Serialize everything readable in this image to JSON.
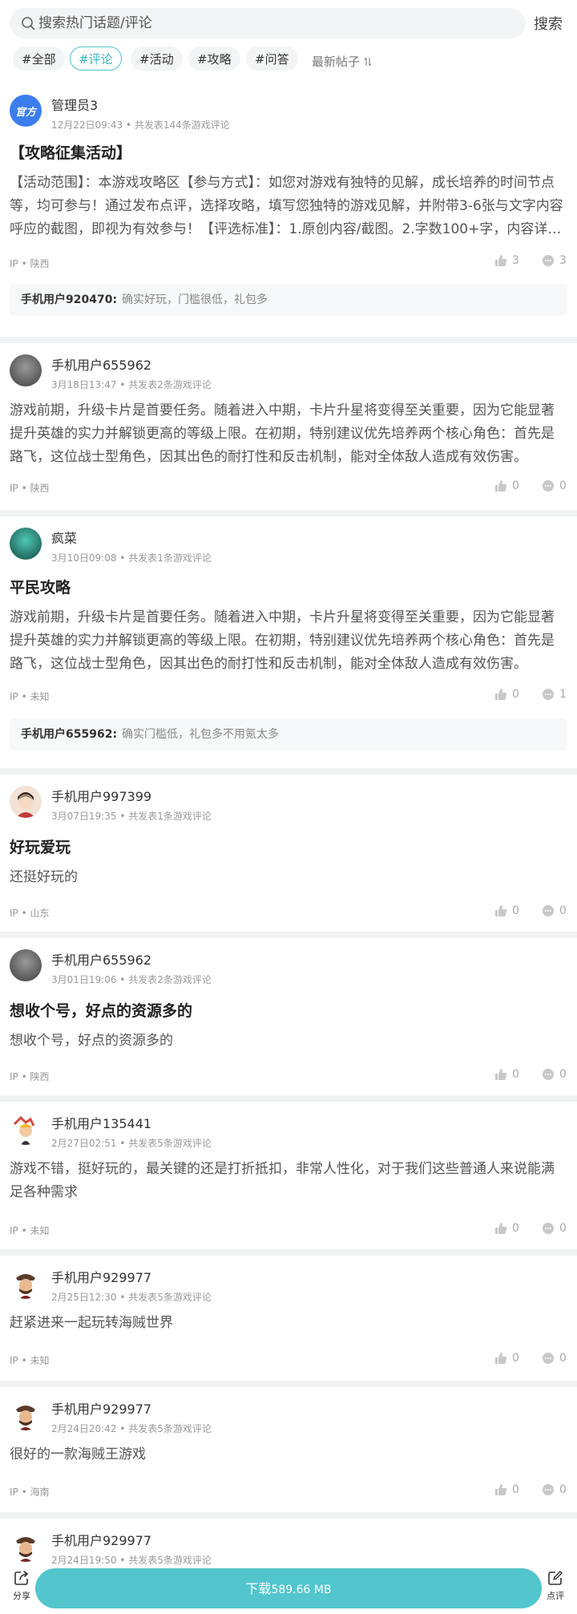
{
  "search": {
    "placeholder": "搜索热门话题/评论",
    "button": "搜索"
  },
  "tabs": [
    "#全部",
    "#评论",
    "#活动",
    "#攻略",
    "#问答"
  ],
  "sort_label": "最新帖子",
  "posts": [
    {
      "user": "管理员3",
      "date": "12月22日09:43",
      "stats": "共发表144条游戏评论",
      "title": "【攻略征集活动】",
      "body": "【活动范围】：本游戏攻略区【参与方式】：如您对游戏有独特的见解，成长培养的时间节点等，均可参与！通过发布点评，选择攻略，填写您独特的游戏见解，并附带3-6张与文字内容呼应的截图，即视为有效参与！【评选标准】：1.原创内容/截图。2.字数100+字，内容详实，图文并茂。",
      "ip": "IP • 陕西",
      "likes": "3",
      "comments": "3",
      "reply": {
        "user": "手机用户920470:",
        "text": "确实好玩，门槛很低，礼包多"
      }
    },
    {
      "user": "手机用户655962",
      "date": "3月18日13:47",
      "stats": "共发表2条游戏评论",
      "body": "游戏前期，升级卡片是首要任务。随着进入中期，卡片升星将变得至关重要，因为它能显著提升英雄的实力并解锁更高的等级上限。在初期，特别建议优先培养两个核心角色：首先是路飞，这位战士型角色，因其出色的耐打性和反击机制，能对全体敌人造成有效伤害。",
      "ip": "IP • 陕西",
      "likes": "0",
      "comments": "0"
    },
    {
      "user": "疯菜",
      "date": "3月10日09:08",
      "stats": "共发表1条游戏评论",
      "title": "平民攻略",
      "body": "游戏前期，升级卡片是首要任务。随着进入中期，卡片升星将变得至关重要，因为它能显著提升英雄的实力并解锁更高的等级上限。在初期，特别建议优先培养两个核心角色：首先是路飞，这位战士型角色，因其出色的耐打性和反击机制，能对全体敌人造成有效伤害。",
      "ip": "IP • 未知",
      "likes": "0",
      "comments": "1",
      "reply": {
        "user": "手机用户655962:",
        "text": "确实门槛低，礼包多不用氪太多"
      }
    },
    {
      "user": "手机用户997399",
      "date": "3月07日19:35",
      "stats": "共发表1条游戏评论",
      "title": "好玩爱玩",
      "body": "还挺好玩的",
      "ip": "IP • 山东",
      "likes": "0",
      "comments": "0"
    },
    {
      "user": "手机用户655962",
      "date": "3月01日19:06",
      "stats": "共发表2条游戏评论",
      "title": "想收个号，好点的资源多的",
      "body": "想收个号，好点的资源多的",
      "ip": "IP • 陕西",
      "likes": "0",
      "comments": "0"
    },
    {
      "user": "手机用户135441",
      "date": "2月27日02:51",
      "stats": "共发表5条游戏评论",
      "body": "游戏不错，挺好玩的，最关键的还是打折抵扣，非常人性化，对于我们这些普通人来说能满足各种需求",
      "ip": "IP • 未知",
      "likes": "0",
      "comments": "0"
    },
    {
      "user": "手机用户929977",
      "date": "2月25日12:30",
      "stats": "共发表5条游戏评论",
      "body": "赶紧进来一起玩转海贼世界",
      "ip": "IP • 未知",
      "likes": "0",
      "comments": "0"
    },
    {
      "user": "手机用户929977",
      "date": "2月24日20:42",
      "stats": "共发表5条游戏评论",
      "body": "很好的一款海贼王游戏",
      "ip": "IP • 海南",
      "likes": "0",
      "comments": "0"
    },
    {
      "user": "手机用户929977",
      "date": "2月24日19:50",
      "stats": "共发表5条游戏评论"
    }
  ],
  "official_badge": "官方",
  "bottom": {
    "share": "分享",
    "download": "下载",
    "size": "589.66 MB",
    "review": "点评"
  },
  "colors": {
    "accent": "#52c5cd",
    "tag_active": "#3ab7c0"
  }
}
